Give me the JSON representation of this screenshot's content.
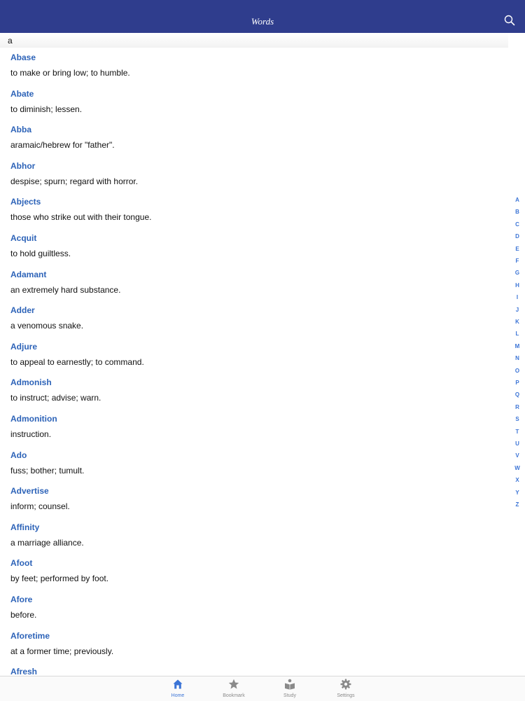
{
  "nav": {
    "title": "Words",
    "search_icon": "search-icon"
  },
  "search": {
    "value": "a"
  },
  "words": [
    {
      "term": "Abase",
      "definition": "to make or bring low; to humble."
    },
    {
      "term": "Abate",
      "definition": "to diminish; lessen."
    },
    {
      "term": "Abba",
      "definition": "aramaic/hebrew for \"father\"."
    },
    {
      "term": "Abhor",
      "definition": "despise; spurn; regard with horror."
    },
    {
      "term": "Abjects",
      "definition": "those who strike out with their tongue."
    },
    {
      "term": "Acquit",
      "definition": "to hold guiltless."
    },
    {
      "term": "Adamant",
      "definition": "an extremely hard substance."
    },
    {
      "term": "Adder",
      "definition": "a venomous snake."
    },
    {
      "term": "Adjure",
      "definition": "to appeal to earnestly; to command."
    },
    {
      "term": "Admonish",
      "definition": "to instruct; advise; warn."
    },
    {
      "term": "Admonition",
      "definition": "instruction."
    },
    {
      "term": "Ado",
      "definition": "fuss; bother; tumult."
    },
    {
      "term": "Advertise",
      "definition": "inform; counsel."
    },
    {
      "term": "Affinity",
      "definition": "a marriage alliance."
    },
    {
      "term": "Afoot",
      "definition": "by feet; performed by foot."
    },
    {
      "term": "Afore",
      "definition": "before."
    },
    {
      "term": "Aforetime",
      "definition": "at a former time; previously."
    },
    {
      "term": "Afresh",
      "definition": ""
    }
  ],
  "alpha_index": [
    "A",
    "B",
    "C",
    "D",
    "E",
    "F",
    "G",
    "H",
    "I",
    "J",
    "K",
    "L",
    "M",
    "N",
    "O",
    "P",
    "Q",
    "R",
    "S",
    "T",
    "U",
    "V",
    "W",
    "X",
    "Y",
    "Z"
  ],
  "tabs": [
    {
      "label": "Home",
      "icon": "home-icon",
      "active": true
    },
    {
      "label": "Bookmark",
      "icon": "star-icon",
      "active": false
    },
    {
      "label": "Study",
      "icon": "book-reader-icon",
      "active": false
    },
    {
      "label": "Settings",
      "icon": "gear-icon",
      "active": false
    }
  ],
  "colors": {
    "navbar": "#2f3d8d",
    "term": "#2d63b8",
    "accent": "#3b74d6",
    "tab_inactive": "#8a8a8a"
  }
}
